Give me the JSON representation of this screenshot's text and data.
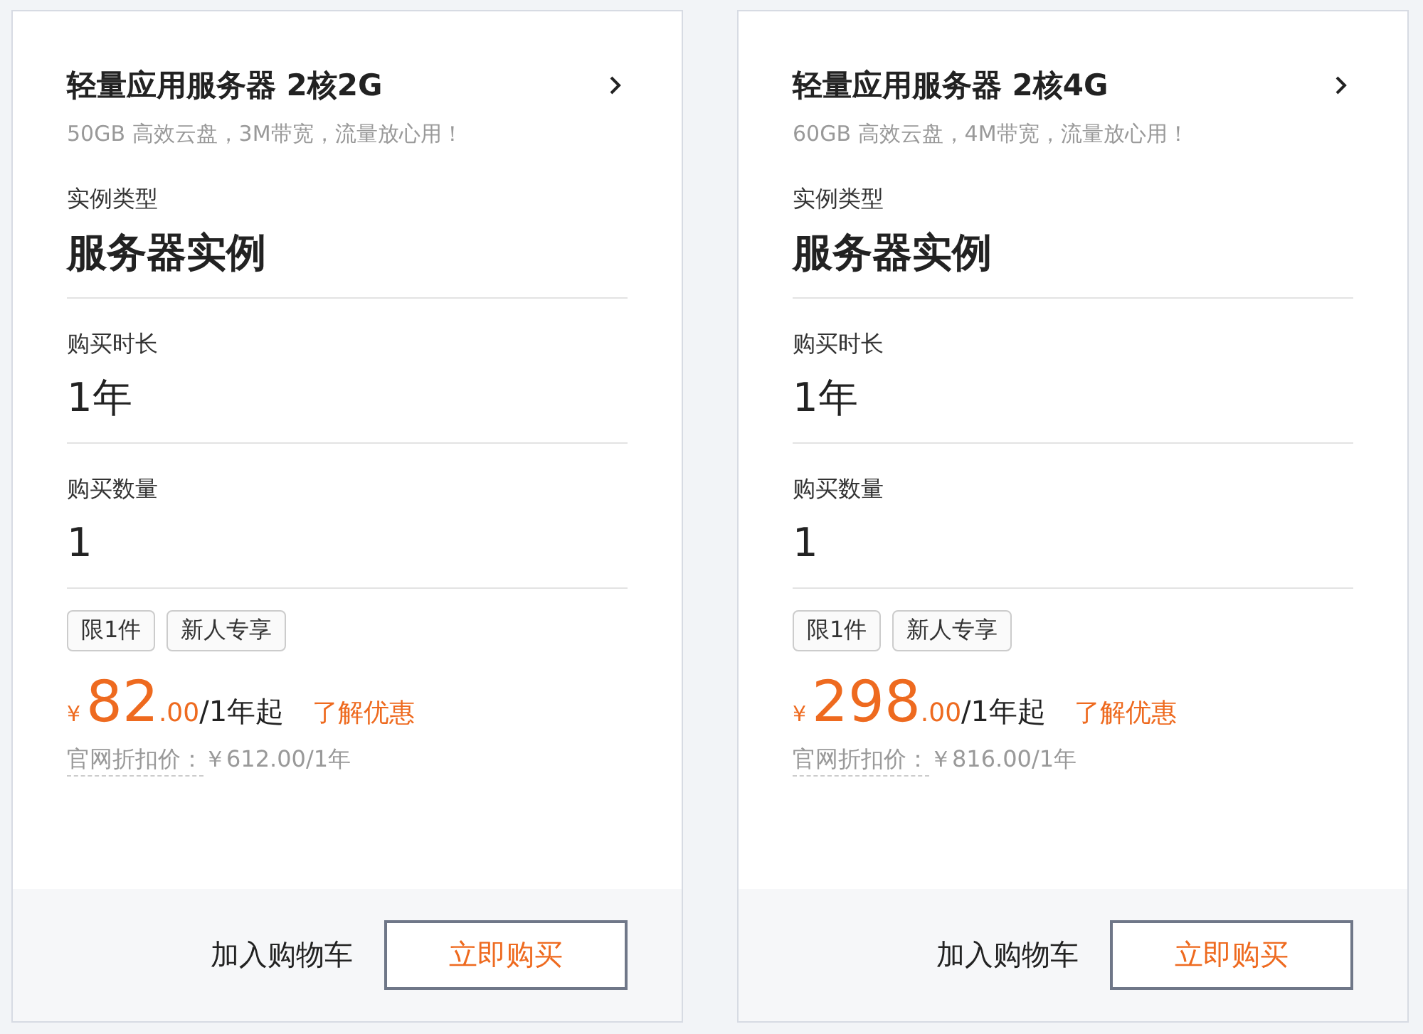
{
  "products": [
    {
      "title": "轻量应用服务器 2核2G",
      "subtitle": "50GB 高效云盘，3M带宽，流量放心用！",
      "fields": [
        {
          "label": "实例类型",
          "value": "服务器实例"
        },
        {
          "label": "购买时长",
          "value": "1年"
        },
        {
          "label": "购买数量",
          "value": "1"
        }
      ],
      "tags": [
        "限1件",
        "新人专享"
      ],
      "price": {
        "currency": "¥",
        "integer": "82",
        "decimal": ".00",
        "unit": "/1年起"
      },
      "offer_link": "了解优惠",
      "list_price_label": "官网折扣价：",
      "list_price": "￥612.00/1年",
      "add_to_cart": "加入购物车",
      "buy_now": "立即购买"
    },
    {
      "title": "轻量应用服务器 2核4G",
      "subtitle": "60GB 高效云盘，4M带宽，流量放心用！",
      "fields": [
        {
          "label": "实例类型",
          "value": "服务器实例"
        },
        {
          "label": "购买时长",
          "value": "1年"
        },
        {
          "label": "购买数量",
          "value": "1"
        }
      ],
      "tags": [
        "限1件",
        "新人专享"
      ],
      "price": {
        "currency": "¥",
        "integer": "298",
        "decimal": ".00",
        "unit": "/1年起"
      },
      "offer_link": "了解优惠",
      "list_price_label": "官网折扣价：",
      "list_price": "￥816.00/1年",
      "add_to_cart": "加入购物车",
      "buy_now": "立即购买"
    }
  ]
}
